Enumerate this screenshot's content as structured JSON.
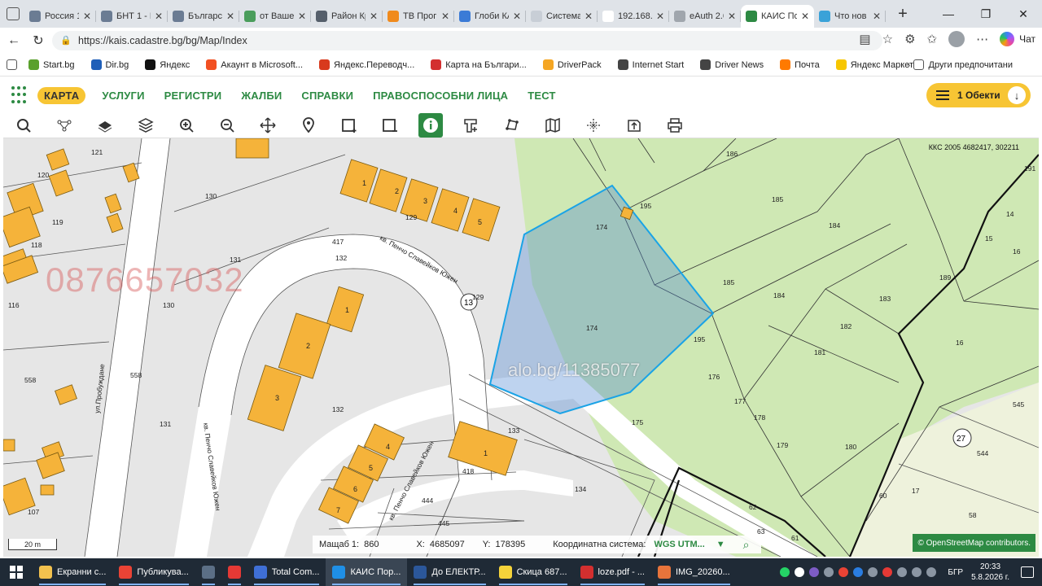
{
  "browser": {
    "tabs": [
      {
        "title": "Россия 1",
        "color": "#6b7c93"
      },
      {
        "title": "БНТ 1 - Е",
        "color": "#6b7c93"
      },
      {
        "title": "Българск",
        "color": "#6b7c93"
      },
      {
        "title": "от Вашет",
        "color": "#4a9d5b"
      },
      {
        "title": "Район Кр",
        "color": "#555f6b"
      },
      {
        "title": "ТВ Прогр",
        "color": "#f08a1c"
      },
      {
        "title": "Глоби КА",
        "color": "#3b7bd6"
      },
      {
        "title": "Система",
        "color": "#c8ced6"
      },
      {
        "title": "192.168.",
        "color": "#ffffff"
      },
      {
        "title": "eAuth 2.0",
        "color": "#a0a6ad"
      },
      {
        "title": "КАИС По",
        "color": "#2d8a43",
        "active": true
      },
      {
        "title": "Что нов",
        "color": "#3aa2d8"
      }
    ],
    "url": "https://kais.cadastre.bg/bg/Map/Index",
    "copilot_label": "Чат"
  },
  "bookmarks": [
    {
      "label": "Start.bg",
      "color": "#5aa02c"
    },
    {
      "label": "Dir.bg",
      "color": "#1f5fb8"
    },
    {
      "label": "Яндекс",
      "color": "#111111"
    },
    {
      "label": "Акаунт в Microsoft...",
      "color": "#f25022"
    },
    {
      "label": "Яндекс.Переводч...",
      "color": "#d83a1d"
    },
    {
      "label": "Карта на Българи...",
      "color": "#d32f2f"
    },
    {
      "label": "DriverPack",
      "color": "#f5a623"
    },
    {
      "label": "Internet Start",
      "color": "#444444"
    },
    {
      "label": "Driver News",
      "color": "#444444"
    },
    {
      "label": "Почта",
      "color": "#ff7a00"
    },
    {
      "label": "Яндекс Маркет",
      "color": "#f7c600"
    }
  ],
  "bookmarks_other": "Други предпочитани",
  "app": {
    "menu": [
      "КАРТА",
      "УСЛУГИ",
      "РЕГИСТРИ",
      "ЖАЛБИ",
      "СПРАВКИ",
      "ПРАВОСПОСОБНИ ЛИЦА",
      "ТЕСТ"
    ],
    "active_menu": "КАРТА",
    "objects_button": "1 Обекти",
    "accent": "#2d8a43",
    "yellow": "#f7c534"
  },
  "toolbar_icons": [
    "search-icon",
    "layers-tree-icon",
    "layer-icon",
    "layers-stack-icon",
    "zoom-in-icon",
    "zoom-out-icon",
    "pan-icon",
    "marker-icon",
    "select-rect-icon",
    "select-area-icon",
    "info-icon",
    "measure-icon",
    "polygon-icon",
    "map-icon",
    "coordinates-icon",
    "export-icon",
    "print-icon"
  ],
  "map": {
    "coord_label": "ККС 2005 4682417, 302211",
    "watermark_phone": "0876657032",
    "watermark_site": "alo.bg/11385077",
    "scale_bar": "20 m",
    "street_labels": {
      "pencho_top": "кв. Пенчо Славейков Южен",
      "probujdane": "ул.Пробуждане",
      "pencho_left": "кв. Пенчо Славейков Южен",
      "pencho_bottom": "кв. Пенчо Славейков Южен"
    },
    "parcel_labels": [
      "130",
      "131",
      "132",
      "417",
      "129",
      "130",
      "131",
      "132",
      "133",
      "418",
      "134",
      "444",
      "445",
      "174",
      "174",
      "175",
      "176",
      "177",
      "178",
      "179",
      "180",
      "181",
      "182",
      "183",
      "184",
      "185",
      "186",
      "189",
      "191",
      "195",
      "195",
      "14",
      "15",
      "16",
      "16",
      "17",
      "58",
      "60",
      "61",
      "62",
      "63",
      "544",
      "545",
      "558",
      "107",
      "116",
      "118",
      "119",
      "120",
      "121"
    ],
    "building_numbers": [
      "1",
      "2",
      "3",
      "4",
      "5",
      "1",
      "2",
      "3",
      "1",
      "2",
      "3",
      "4",
      "5",
      "6",
      "7"
    ],
    "round_labels": [
      "13",
      "27"
    ],
    "colors": {
      "green": "#cfe8b4",
      "gray": "#e6e6e6",
      "building": "#f5b33a",
      "selection": "#1aa3e6"
    },
    "status": {
      "scale_label": "Мащаб 1:",
      "scale_value": "860",
      "x_label": "X:",
      "x_value": "4685097",
      "y_label": "Y:",
      "y_value": "178395",
      "crs_label": "Координатна система:",
      "crs_value": "WGS UTM..."
    },
    "attribution": "© OpenStreetMap contributors."
  },
  "taskbar": {
    "items": [
      {
        "label": "Екранни с...",
        "color": "#f2c14e"
      },
      {
        "label": "Публикува...",
        "color": "#ea4335"
      },
      {
        "label": "",
        "color": "#5b6f86"
      },
      {
        "label": "",
        "color": "#e53935"
      },
      {
        "label": "Total Com...",
        "color": "#3f6fd6"
      },
      {
        "label": "КАИС Пор...",
        "color": "#1f8fe6",
        "active": true
      },
      {
        "label": "До ЕЛЕКТР...",
        "color": "#2b579a"
      },
      {
        "label": "Скица 687...",
        "color": "#f5d33a"
      },
      {
        "label": "loze.pdf - ...",
        "color": "#d32f2f"
      },
      {
        "label": "IMG_20260...",
        "color": "#e8743b"
      }
    ],
    "lang": "БГР",
    "time": "20:33",
    "date": "5.8.2026 г."
  }
}
